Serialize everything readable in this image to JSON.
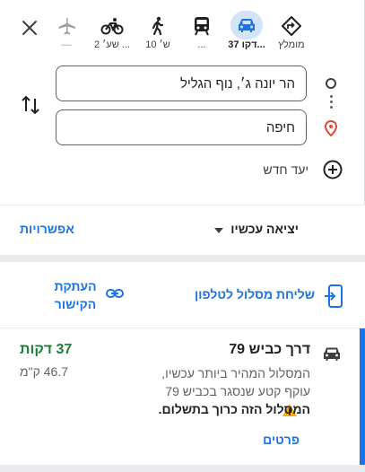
{
  "colors": {
    "accent": "#1a73e8",
    "active_mode_bg": "#d2e3fc",
    "duration_green": "#188038",
    "warning_yellow": "#f9ab00",
    "destination_pin_red": "#ea4335"
  },
  "travel_modes": [
    {
      "id": "best",
      "icon": "directions-diamond-icon",
      "label": "מומלץ",
      "active": false
    },
    {
      "id": "driving",
      "icon": "car-icon",
      "label": "37 דקו...",
      "active": true
    },
    {
      "id": "transit",
      "icon": "train-icon",
      "label": "...",
      "active": false
    },
    {
      "id": "walking",
      "icon": "walking-icon",
      "label": "10 ש׳",
      "active": false
    },
    {
      "id": "cycling",
      "icon": "bicycle-icon",
      "label": "2 שע׳ ...",
      "active": false
    },
    {
      "id": "flight",
      "icon": "airplane-icon",
      "label": "—",
      "active": false
    }
  ],
  "directions": {
    "origin_value": "הר יונה ג׳, נוף הגליל",
    "destination_value": "חיפה",
    "add_destination_label": "יעד חדש"
  },
  "depart": {
    "label": "יציאה עכשיו",
    "options_label": "אפשרויות"
  },
  "share": {
    "send_to_phone_label": "שליחת מסלול לטלפון",
    "copy_link_label": "העתקת הקישור"
  },
  "route": {
    "via": "דרך כביש 79",
    "duration": "37 דקות",
    "distance": "46.7 ק\"מ",
    "description": "המסלול המהיר ביותר עכשיו, עוקף קטע שנסגר בכביש 79",
    "warning": "המסלול הזה כרוך בתשלום.",
    "details_label": "פרטים"
  }
}
